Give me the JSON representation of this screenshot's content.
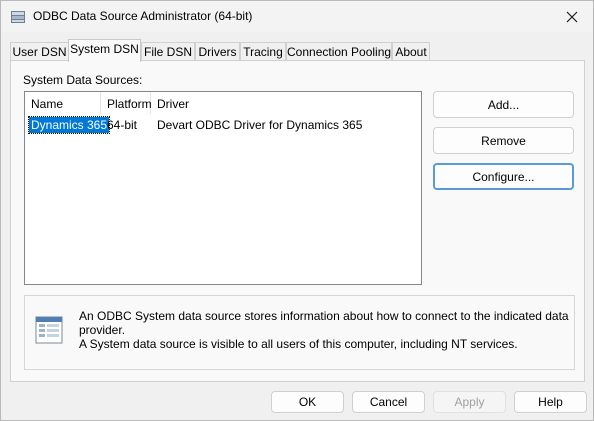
{
  "window": {
    "title": "ODBC Data Source Administrator (64-bit)",
    "close_icon": "close-icon"
  },
  "tabs": [
    {
      "label": "User DSN",
      "active": false
    },
    {
      "label": "System DSN",
      "active": true
    },
    {
      "label": "File DSN",
      "active": false
    },
    {
      "label": "Drivers",
      "active": false
    },
    {
      "label": "Tracing",
      "active": false
    },
    {
      "label": "Connection Pooling",
      "active": false
    },
    {
      "label": "About",
      "active": false
    }
  ],
  "panel": {
    "group_label": "System Data Sources:",
    "columns": [
      "Name",
      "Platform",
      "Driver"
    ],
    "rows": [
      {
        "name": "Dynamics 365",
        "platform": "64-bit",
        "driver": "Devart ODBC Driver for Dynamics 365",
        "selected": true
      }
    ],
    "buttons": {
      "add": "Add...",
      "remove": "Remove",
      "configure": "Configure..."
    },
    "info": {
      "line1": "An ODBC System data source stores information about how to connect to the indicated data provider.",
      "line2": "A System data source is visible to all users of this computer, including NT services.",
      "icon": "data-source-icon"
    }
  },
  "footer": {
    "ok": "OK",
    "cancel": "Cancel",
    "apply": "Apply",
    "help": "Help"
  },
  "colors": {
    "selection": "#0078d7",
    "focus_border": "#5b9bd5"
  }
}
